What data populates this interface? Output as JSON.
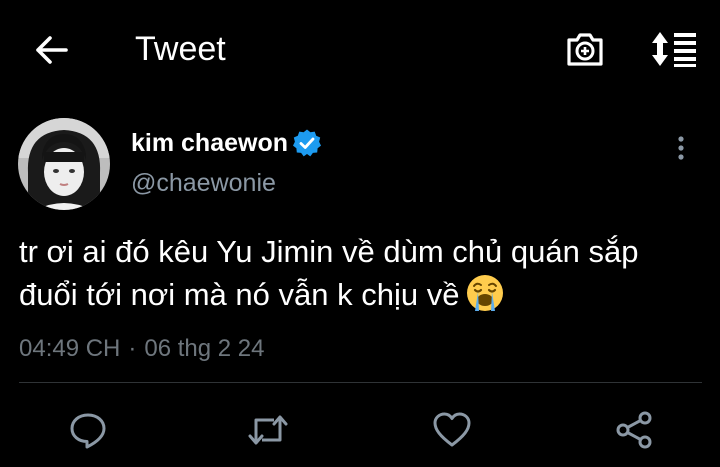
{
  "header": {
    "back_icon": "arrow-left-icon",
    "title": "Tweet",
    "camera_icon": "camera-plus-icon",
    "sort_icon": "sort-list-icon"
  },
  "tweet": {
    "author": {
      "display_name": "kim chaewon",
      "handle": "@chaewonie",
      "verified": true,
      "verified_icon": "verified-badge-icon"
    },
    "text_line1": "tr ơi ai đó kêu Yu Jimin về dùm chủ quán sắp",
    "text_line2": "đuổi tới nơi mà nó vẫn k chịu về",
    "emoji": "loudly-crying-face-emoji",
    "time": "04:49 CH",
    "separator": "·",
    "date": "06 thg 2 24"
  },
  "actions": [
    {
      "name": "reply",
      "icon": "reply-bubble-icon"
    },
    {
      "name": "retweet",
      "icon": "retweet-icon"
    },
    {
      "name": "like",
      "icon": "heart-icon"
    },
    {
      "name": "share",
      "icon": "share-icon"
    }
  ],
  "colors": {
    "background": "#000000",
    "text_primary": "#ffffff",
    "text_secondary": "#8b98a5",
    "text_meta": "#6e767d",
    "verified_blue": "#1d9bf0",
    "divider": "#2f3336"
  }
}
